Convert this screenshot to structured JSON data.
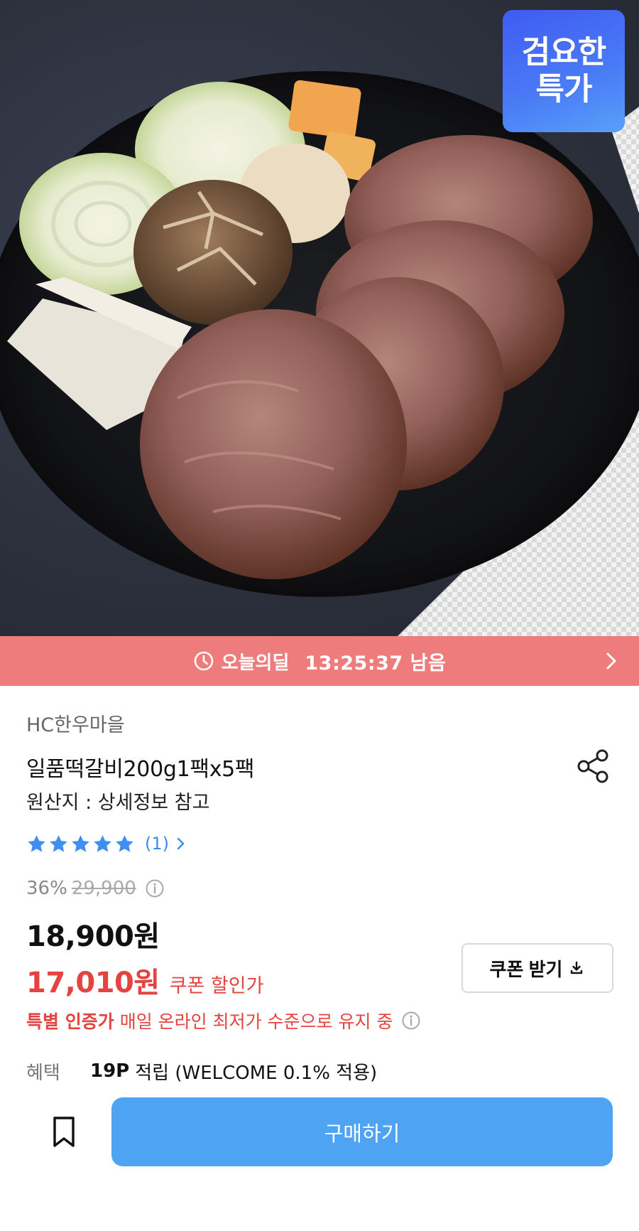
{
  "product_image": {
    "description_icon": "food-photo",
    "badge": {
      "line1": "검요한",
      "line2": "특가"
    }
  },
  "deal_bar": {
    "label": "오늘의딜",
    "timer": "13:25:37 남음",
    "color": "#ef7c7c"
  },
  "product": {
    "brand": "HC한우마을",
    "title": "일품떡갈비200g1팩x5팩",
    "origin": "원산지 : 상세정보 참고",
    "rating": {
      "stars": 5,
      "count_label": "(1)"
    },
    "discount_percent": "36%",
    "original_price": "29,900",
    "price": "18,900원",
    "coupon_price": "17,010원",
    "coupon_label": "쿠폰 할인가",
    "coupon_button": "쿠폰 받기",
    "cert_strong": "특별 인증가",
    "cert_desc": "매일 온라인 최저가 수준으로 유지 중",
    "benefit_key": "혜택",
    "benefit_points": "19P",
    "benefit_desc": "적립 (WELCOME 0.1% 적용)"
  },
  "actions": {
    "buy_label": "구매하기",
    "accent": "#4ea3f2",
    "sale_color": "#e5433f"
  }
}
